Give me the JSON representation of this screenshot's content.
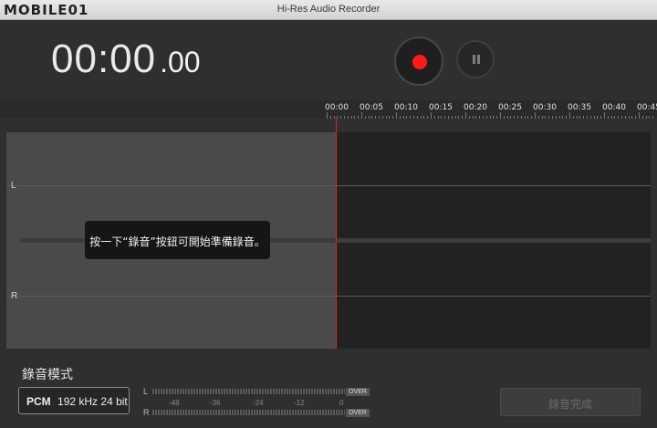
{
  "window": {
    "title": "Hi-Res Audio Recorder",
    "watermark": "MOBILE01"
  },
  "timer": {
    "main": "00:00",
    "fraction": ".00"
  },
  "controls": {
    "record": "record",
    "pause": "pause",
    "record_color": "#ff1a1a"
  },
  "ruler": {
    "ticks": [
      "00:00",
      "00:05",
      "00:10",
      "00:15",
      "00:20",
      "00:25",
      "00:30",
      "00:35",
      "00:40",
      "00:45"
    ]
  },
  "track": {
    "channel_left": "L",
    "channel_right": "R",
    "hint": "按一下“錄音”按鈕可開始準備錄音。"
  },
  "bottom": {
    "mode_label": "錄音模式",
    "format": {
      "codec": "PCM",
      "rate": "192 kHz",
      "bits": "24 bit"
    },
    "meter": {
      "left": "L",
      "right": "R",
      "over": "OVER",
      "scale": [
        "-48",
        "-36",
        "-24",
        "-12",
        "0"
      ]
    },
    "done_button": "錄音完成"
  }
}
